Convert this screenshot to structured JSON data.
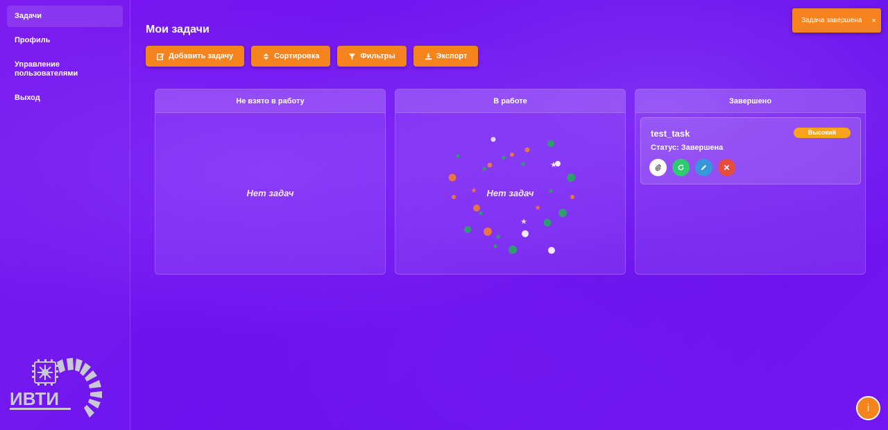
{
  "sidebar": {
    "items": [
      {
        "label": "Задачи",
        "active": true
      },
      {
        "label": "Профиль"
      },
      {
        "label": "Управление пользователями"
      },
      {
        "label": "Выход"
      }
    ],
    "logo_text": "ИВТИ"
  },
  "main": {
    "title": "Мои задачи",
    "toolbar": {
      "add_task": "Добавить задачу",
      "sort": "Сортировка",
      "filters": "Фильтры",
      "export": "Экспорт"
    },
    "columns": [
      {
        "title": "Не взято в работу",
        "empty_text": "Нет задач"
      },
      {
        "title": "В работе",
        "empty_text": "Нет задач"
      },
      {
        "title": "Завершено",
        "tasks": [
          {
            "name": "test_task",
            "priority": "Высокий",
            "status": "Статус: Завершена"
          }
        ]
      }
    ]
  },
  "toast": {
    "message": "Задача завершена",
    "close_symbol": "×"
  },
  "help_button": {
    "label": "i"
  },
  "colors": {
    "accent": "#f5841f",
    "priority_high": "#f9a21d",
    "attach": "#ffffff",
    "restore": "#2ecc71",
    "edit": "#3498db",
    "delete": "#e74c3c"
  },
  "icons": {
    "add_task": "edit-square-icon",
    "sort": "sort-icon",
    "filters": "filter-icon",
    "export": "download-icon",
    "task_actions": [
      "paperclip-icon",
      "refresh-icon",
      "pencil-icon",
      "close-icon"
    ]
  }
}
